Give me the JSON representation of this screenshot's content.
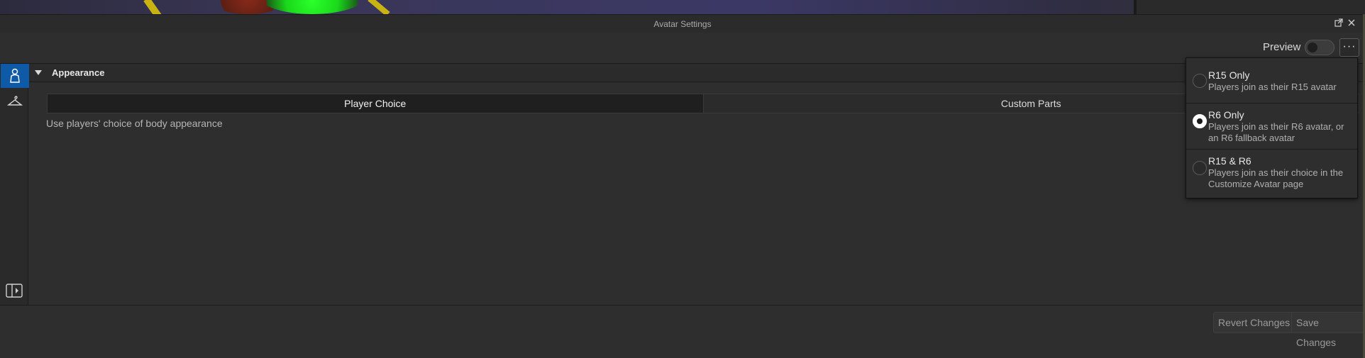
{
  "window": {
    "title": "Avatar Settings"
  },
  "toolbar": {
    "preview_label": "Preview",
    "more_label": "···"
  },
  "section": {
    "title": "Appearance"
  },
  "tabs": [
    {
      "label": "Player Choice",
      "active": true
    },
    {
      "label": "Custom Parts",
      "active": false
    }
  ],
  "description": "Use players' choice of body appearance",
  "dropdown": {
    "options": [
      {
        "title": "R15 Only",
        "desc": "Players join as their R15 avatar",
        "selected": false
      },
      {
        "title": "R6 Only",
        "desc": "Players join as their R6 avatar, or an R6 fallback avatar",
        "selected": true
      },
      {
        "title": "R15 & R6",
        "desc": "Players join as their choice in the Customize Avatar page",
        "selected": false
      }
    ]
  },
  "footer": {
    "revert_label": "Revert Changes",
    "save_label": "Save Changes"
  },
  "colors": {
    "accent": "#0e5aa7",
    "background": "#2e2e2e"
  }
}
